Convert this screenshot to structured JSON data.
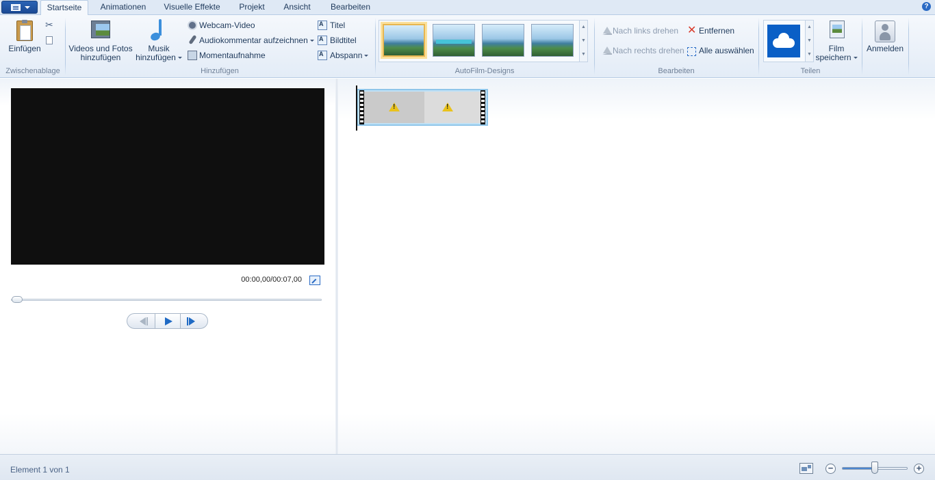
{
  "tabs": [
    {
      "label": "Startseite"
    },
    {
      "label": "Animationen"
    },
    {
      "label": "Visuelle Effekte"
    },
    {
      "label": "Projekt"
    },
    {
      "label": "Ansicht"
    },
    {
      "label": "Bearbeiten"
    }
  ],
  "help": "?",
  "ribbon": {
    "clipboard": {
      "paste": "Einfügen",
      "group": "Zwischenablage"
    },
    "add": {
      "videos_line1": "Videos und Fotos",
      "videos_line2": "hinzufügen",
      "music_line1": "Musik",
      "music_line2": "hinzufügen",
      "webcam": "Webcam-Video",
      "audio": "Audiokommentar aufzeichnen",
      "snapshot": "Momentaufnahme",
      "title": "Titel",
      "caption": "Bildtitel",
      "credits": "Abspann",
      "group": "Hinzufügen"
    },
    "autofilm": {
      "group": "AutoFilm-Designs",
      "selected_index": 0
    },
    "edit": {
      "rotate_left": "Nach links drehen",
      "rotate_right": "Nach rechts drehen",
      "remove": "Entfernen",
      "select_all": "Alle auswählen",
      "group": "Bearbeiten"
    },
    "share": {
      "save_line1": "Film",
      "save_line2": "speichern",
      "group": "Teilen"
    },
    "signin": "Anmelden"
  },
  "preview": {
    "timecode": "00:00,00/00:07,00",
    "progress": 0
  },
  "status": {
    "text": "Element 1 von 1",
    "zoom_level": 0.5
  },
  "colors": {
    "accent": "#1f6ac4",
    "onedrive": "#0a5fc6",
    "remove": "#d83a2a",
    "selected_theme": "#e7b650"
  }
}
